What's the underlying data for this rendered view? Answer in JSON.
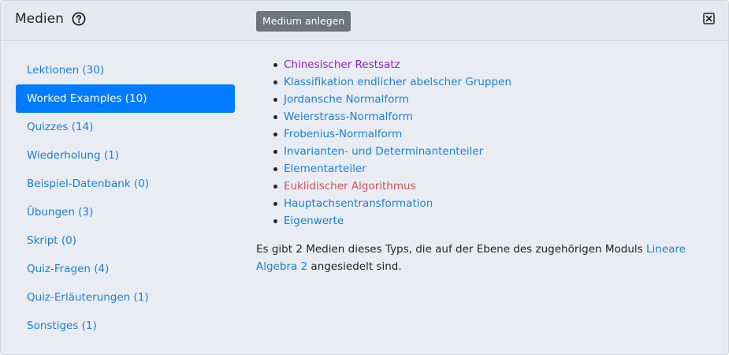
{
  "header": {
    "title": "Medien",
    "help_icon": "question-circle-icon",
    "new_button_label": "Medium anlegen",
    "close_icon": "close-square-icon"
  },
  "sidebar": {
    "items": [
      {
        "label": "Lektionen (30)",
        "active": false
      },
      {
        "label": "Worked Examples (10)",
        "active": true
      },
      {
        "label": "Quizzes (14)",
        "active": false
      },
      {
        "label": "Wiederholung (1)",
        "active": false
      },
      {
        "label": "Beispiel-Datenbank (0)",
        "active": false
      },
      {
        "label": "Übungen (3)",
        "active": false
      },
      {
        "label": "Skript (0)",
        "active": false
      },
      {
        "label": "Quiz-Fragen (4)",
        "active": false
      },
      {
        "label": "Quiz-Erläuterungen (1)",
        "active": false
      },
      {
        "label": "Sonstiges (1)",
        "active": false
      }
    ]
  },
  "media": {
    "items": [
      {
        "label": "Chinesischer Restsatz",
        "state": "visited"
      },
      {
        "label": "Klassifikation endlicher abelscher Gruppen",
        "state": "normal"
      },
      {
        "label": "Jordansche Normalform",
        "state": "normal"
      },
      {
        "label": "Weierstrass-Normalform",
        "state": "normal"
      },
      {
        "label": "Frobenius-Normalform",
        "state": "normal"
      },
      {
        "label": "Invarianten- und Determinantenteiler",
        "state": "normal"
      },
      {
        "label": "Elementarteiler",
        "state": "normal"
      },
      {
        "label": "Euklidischer Algorithmus",
        "state": "danger"
      },
      {
        "label": "Hauptachsentransformation",
        "state": "normal"
      },
      {
        "label": "Eigenwerte",
        "state": "normal"
      }
    ]
  },
  "info": {
    "text_before": "Es gibt 2 Medien dieses Typs, die auf der Ebene des zugehörigen Moduls ",
    "module_link": "Lineare Algebra 2",
    "text_after": " angesiedelt sind."
  },
  "colors": {
    "primary": "#007bff",
    "link": "#1a7fd6",
    "visited": "#8e24c7",
    "danger": "#d05050",
    "secondary_button": "#6c757d"
  }
}
